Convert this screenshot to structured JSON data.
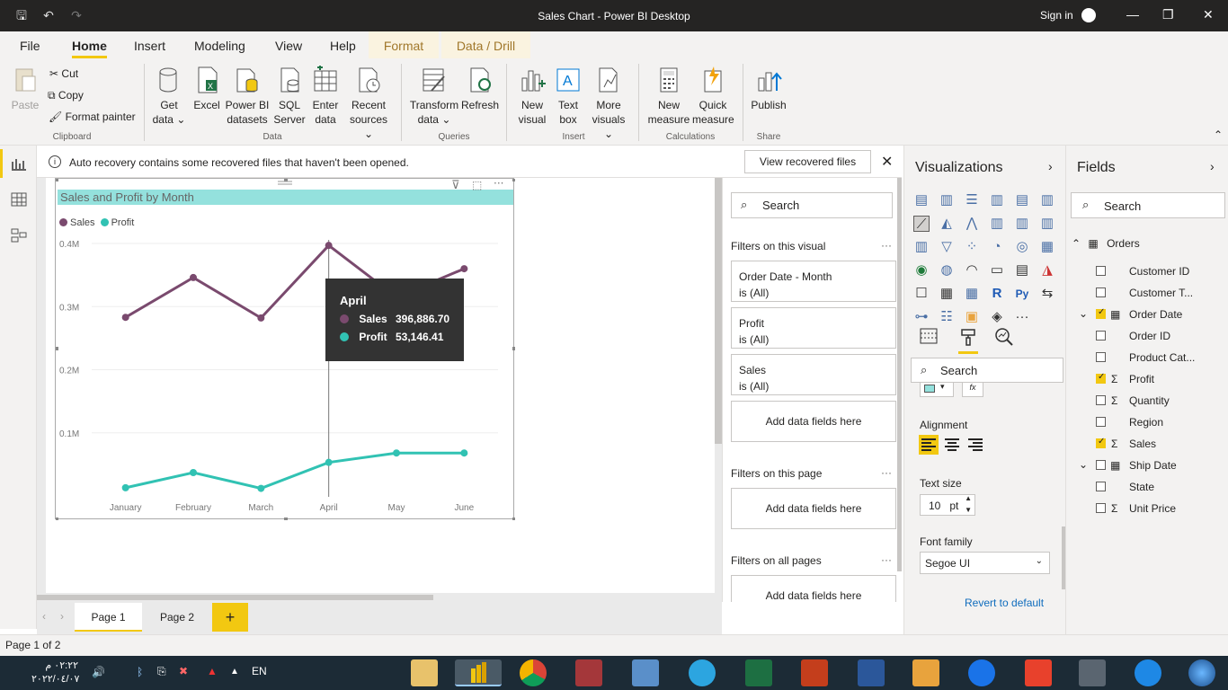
{
  "window": {
    "title": "Sales Chart - Power BI Desktop",
    "sign_in": "Sign in"
  },
  "menu": {
    "file": "File",
    "home": "Home",
    "insert": "Insert",
    "modeling": "Modeling",
    "view": "View",
    "help": "Help",
    "format": "Format",
    "data_drill": "Data / Drill"
  },
  "ribbon": {
    "paste": "Paste",
    "cut": "Cut",
    "copy": "Copy",
    "format_painter": "Format painter",
    "clipboard": "Clipboard",
    "get_data": [
      "Get",
      "data"
    ],
    "excel": "Excel",
    "powerbi_datasets": [
      "Power BI",
      "datasets"
    ],
    "sql_server": [
      "SQL",
      "Server"
    ],
    "enter_data": [
      "Enter",
      "data"
    ],
    "recent_sources": [
      "Recent",
      "sources"
    ],
    "data_group": "Data",
    "transform_data": [
      "Transform",
      "data"
    ],
    "refresh": "Refresh",
    "queries": "Queries",
    "new_visual": [
      "New",
      "visual"
    ],
    "text_box": [
      "Text",
      "box"
    ],
    "more_visuals": [
      "More",
      "visuals"
    ],
    "insert_group": "Insert",
    "new_measure": [
      "New",
      "measure"
    ],
    "quick_measure": [
      "Quick",
      "measure"
    ],
    "calculations": "Calculations",
    "publish": "Publish",
    "share": "Share"
  },
  "infobar": {
    "message": "Auto recovery contains some recovered files that haven't been opened.",
    "button": "View recovered files"
  },
  "chart_data": {
    "type": "line",
    "title": "Sales and Profit by Month",
    "categories": [
      "January",
      "February",
      "March",
      "April",
      "May",
      "June"
    ],
    "series": [
      {
        "name": "Sales",
        "color": "#7a4a6e",
        "values": [
          283000,
          346000,
          282000,
          396886.7,
          315000,
          360000
        ]
      },
      {
        "name": "Profit",
        "color": "#31c2b3",
        "values": [
          13000,
          37000,
          12000,
          53146.41,
          68000,
          68000
        ]
      }
    ],
    "yticks": [
      "0.4M",
      "0.3M",
      "0.2M",
      "0.1M"
    ],
    "ytick_values": [
      400000,
      300000,
      200000,
      100000
    ],
    "ylim": [
      0,
      420000
    ]
  },
  "tooltip": {
    "title": "April",
    "rows": [
      {
        "label": "Sales",
        "value": "396,886.70",
        "color": "#7a4a6e"
      },
      {
        "label": "Profit",
        "value": "53,146.41",
        "color": "#31c2b3"
      }
    ]
  },
  "pages": {
    "tab1": "Page 1",
    "tab2": "Page 2",
    "add": "+",
    "status": "Page 1 of 2"
  },
  "filters": {
    "search": "Search",
    "on_visual": "Filters on this visual",
    "cards": [
      {
        "name": "Order Date - Month",
        "state": "is (All)"
      },
      {
        "name": "Profit",
        "state": "is (All)"
      },
      {
        "name": "Sales",
        "state": "is (All)"
      }
    ],
    "add_fields": "Add data fields here",
    "on_page": "Filters on this page",
    "all_pages": "Filters on all pages"
  },
  "visualizations": {
    "title": "Visualizations",
    "search": "Search",
    "alignment": "Alignment",
    "text_size": "Text size",
    "text_size_value": "10",
    "text_size_unit": "pt",
    "font_family": "Font family",
    "font_family_value": "Segoe UI",
    "revert": "Revert to default"
  },
  "fields": {
    "title": "Fields",
    "search": "Search",
    "table": "Orders",
    "items": [
      {
        "name": "Customer ID",
        "checked": false,
        "sigma": false
      },
      {
        "name": "Customer T...",
        "checked": false,
        "sigma": false
      },
      {
        "name": "Order Date",
        "checked": true,
        "sigma": false
      },
      {
        "name": "Order ID",
        "checked": false,
        "sigma": false
      },
      {
        "name": "Product Cat...",
        "checked": false,
        "sigma": false
      },
      {
        "name": "Profit",
        "checked": true,
        "sigma": true
      },
      {
        "name": "Quantity",
        "checked": false,
        "sigma": true
      },
      {
        "name": "Region",
        "checked": false,
        "sigma": false
      },
      {
        "name": "Sales",
        "checked": true,
        "sigma": true
      },
      {
        "name": "Ship Date",
        "checked": false,
        "sigma": false
      },
      {
        "name": "State",
        "checked": false,
        "sigma": false
      },
      {
        "name": "Unit Price",
        "checked": false,
        "sigma": true
      }
    ]
  },
  "taskbar": {
    "time": "٠٢:٢٢ م",
    "date": "٢٠٢٢/٠٤/٠٧",
    "lang": "EN"
  }
}
